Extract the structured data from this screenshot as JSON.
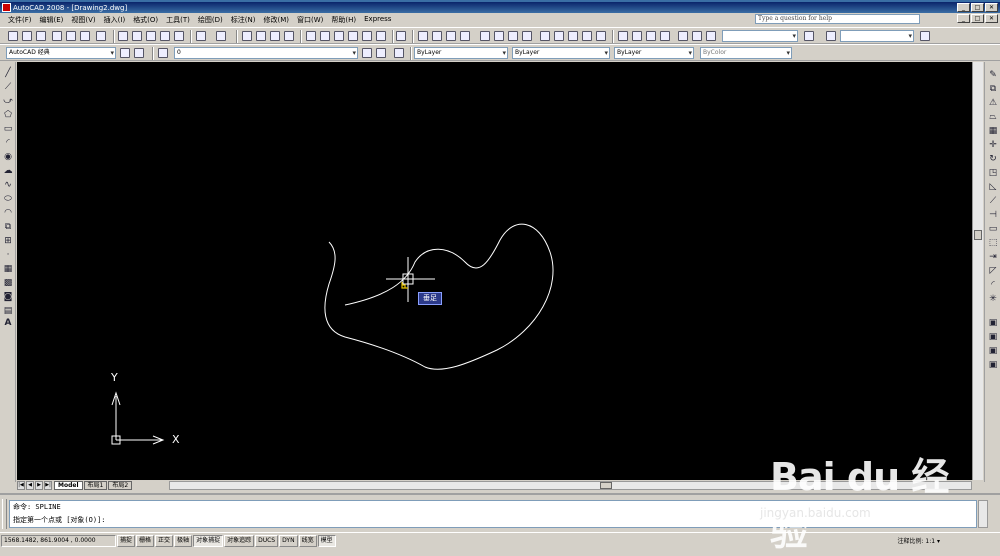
{
  "window": {
    "title": "AutoCAD 2008 - [Drawing2.dwg]",
    "buttons": [
      "_",
      "□",
      "✕"
    ]
  },
  "menu": {
    "items": [
      "文件(F)",
      "编辑(E)",
      "视图(V)",
      "插入(I)",
      "格式(O)",
      "工具(T)",
      "绘图(D)",
      "标注(N)",
      "修改(M)",
      "窗口(W)",
      "帮助(H)",
      "Express"
    ],
    "help_placeholder": "Type a question for help"
  },
  "toolbars": {
    "workspace": "AutoCAD 经典",
    "layer": "0",
    "color": "ByLayer",
    "linetype": "ByLayer",
    "lineweight": "ByLayer",
    "plotstyle": "ByColor"
  },
  "drawing": {
    "tooltip": "垂足",
    "ucs_x": "X",
    "ucs_y": "Y"
  },
  "layout_tabs": {
    "model": "Model",
    "layout1": "布局1",
    "layout2": "布局2"
  },
  "command": {
    "line1": "命令:  SPLINE",
    "line2": "指定第一个点或 [对象(O)]:"
  },
  "status": {
    "coords": "1568.1482, 861.9004 , 0.0000",
    "toggles": [
      "捕捉",
      "栅格",
      "正交",
      "极轴",
      "对象捕捉",
      "对象追踪",
      "DUCS",
      "DYN",
      "线宽",
      "模型"
    ],
    "annotation_scale": "注释比例: 1:1 ▾"
  },
  "watermark": {
    "title": "Bai du 经验",
    "url": "jingyan.baidu.com"
  }
}
